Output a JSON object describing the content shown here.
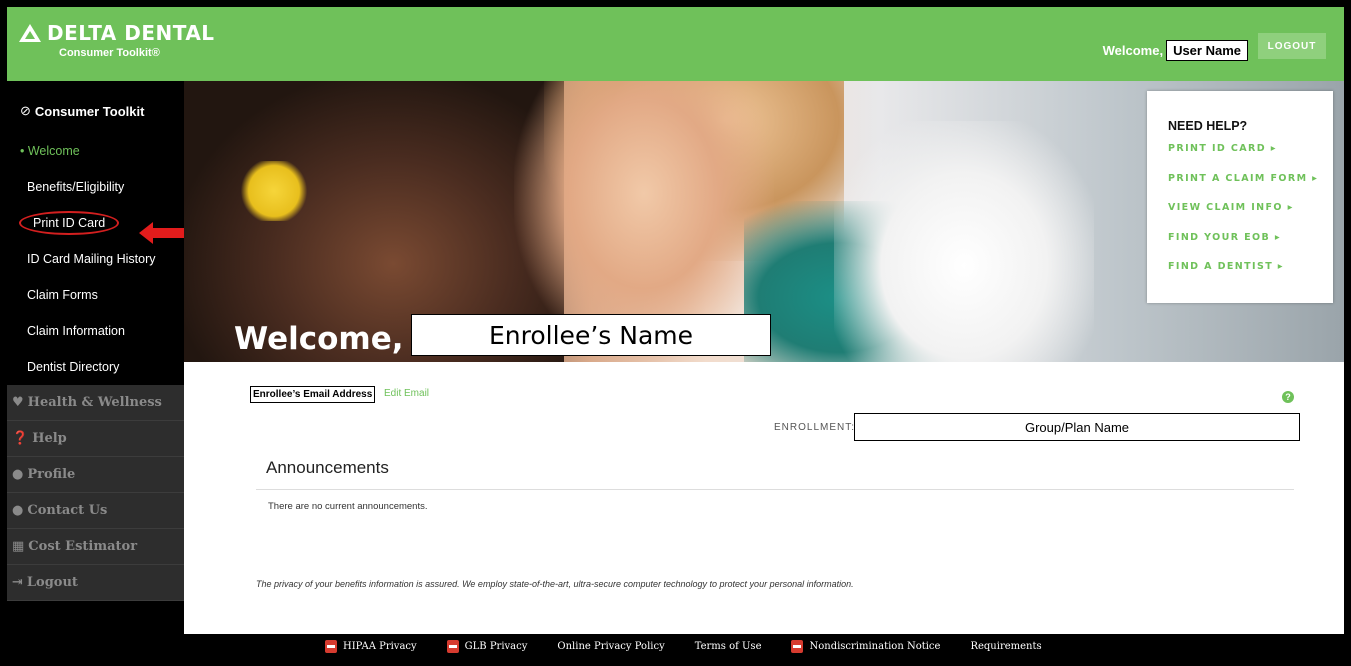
{
  "header": {
    "brand": "DELTA DENTAL",
    "sub": "Consumer Toolkit®",
    "welcome_label": "Welcome,",
    "user_name": "User Name",
    "logout": "LOGOUT"
  },
  "sidebar": {
    "title": "Consumer Toolkit",
    "items": [
      {
        "label": "• Welcome"
      },
      {
        "label": "Benefits/Eligibility"
      },
      {
        "label": "Print ID Card"
      },
      {
        "label": "ID Card Mailing History"
      },
      {
        "label": "Claim Forms"
      },
      {
        "label": "Claim Information"
      },
      {
        "label": "Dentist Directory"
      }
    ],
    "sections": [
      {
        "label": "Health & Wellness",
        "icon": "heart-icon"
      },
      {
        "label": "Help",
        "icon": "question-icon"
      },
      {
        "label": "Profile",
        "icon": "user-icon"
      },
      {
        "label": "Contact Us",
        "icon": "chat-icon"
      },
      {
        "label": "Cost Estimator",
        "icon": "calculator-icon"
      },
      {
        "label": "Logout",
        "icon": "logout-icon"
      }
    ]
  },
  "hero": {
    "welcome": "Welcome,",
    "enrollee_name": "Enrollee’s Name"
  },
  "help_box": {
    "title": "NEED HELP?",
    "links": [
      "PRINT ID CARD ▸",
      "PRINT A CLAIM FORM ▸",
      "VIEW CLAIM INFO ▸",
      "FIND YOUR EOB ▸",
      "FIND A DENTIST ▸"
    ]
  },
  "main": {
    "email": "Enrollee’s Email Address",
    "edit_email": "Edit Email",
    "enrollment_label": "ENROLLMENT:",
    "plan_name": "Group/Plan Name",
    "announcements_title": "Announcements",
    "announcements_text": "There are no current announcements.",
    "privacy_text": "The privacy of your benefits information is assured. We employ state-of-the-art, ultra-secure computer technology to protect your personal information."
  },
  "footer": {
    "links": [
      "HIPAA Privacy",
      "GLB Privacy",
      "Online Privacy Policy",
      "Terms of Use",
      "Nondiscrimination Notice",
      "Requirements"
    ]
  },
  "colors": {
    "accent": "#6fc15a",
    "highlight": "#d31f1f"
  }
}
